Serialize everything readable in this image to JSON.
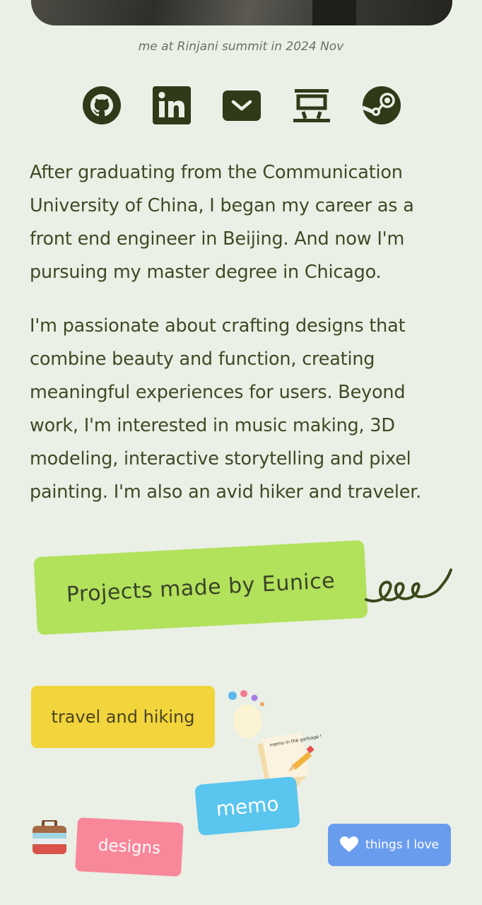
{
  "photo": {
    "caption": "me at Rinjani summit in 2024 Nov"
  },
  "socials": [
    {
      "name": "github",
      "icon": "github-icon"
    },
    {
      "name": "linkedin",
      "icon": "linkedin-icon"
    },
    {
      "name": "email",
      "icon": "mail-icon"
    },
    {
      "name": "douban",
      "icon": "douban-icon"
    },
    {
      "name": "steam",
      "icon": "steam-icon"
    }
  ],
  "bio": {
    "paragraph1": "After graduating from the Communication University of China, I began my career as a front end engineer in Beijing. And now I'm pursuing my master degree in Chicago.",
    "paragraph2": "I'm passionate about crafting designs that combine beauty and function, creating meaningful experiences for users. Beyond work, I'm interested in music making, 3D modeling, interactive storytelling and pixel painting. I'm also an avid hiker and traveler."
  },
  "projects": {
    "label": "Projects made by Eunice"
  },
  "tags": {
    "travel": "travel and hiking",
    "memo": "memo",
    "memo_note": "memo in the garbage time of history",
    "designs": "designs",
    "things": "things I love"
  },
  "colors": {
    "background": "#eaf0e6",
    "text": "#3d4a24",
    "icon": "#2e3a18",
    "projects": "#b2e15c",
    "travel": "#f2d53c",
    "memo": "#5ac5ee",
    "designs": "#f9879a",
    "things": "#6a9cee"
  }
}
